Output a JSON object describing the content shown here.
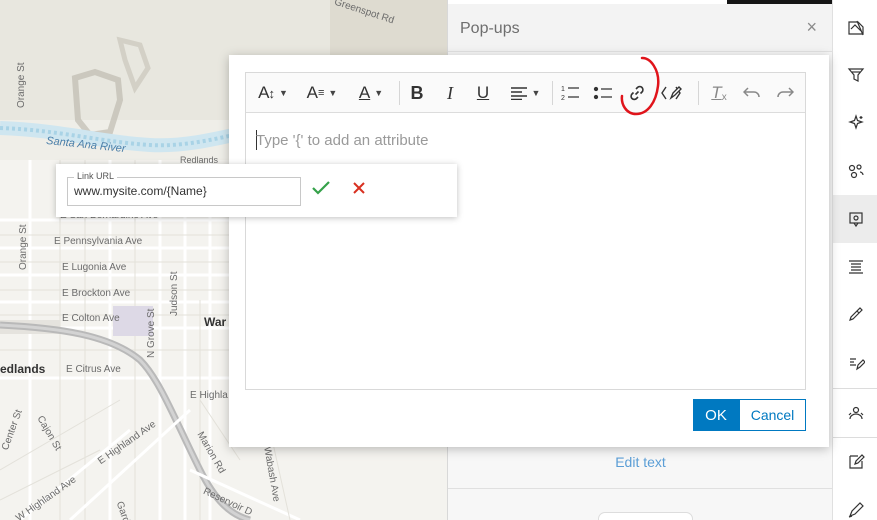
{
  "map": {
    "labels": {
      "greenspot": "Greenspot Rd",
      "orange_st_1": "Orange St",
      "santa_ana": "Santa Ana River",
      "redlands_small": "Redlands",
      "e_san_bernardino": "E San Bernardino Ave",
      "orange_st_2": "Orange St",
      "e_pennsylvania": "E Pennsylvania Ave",
      "e_lugonia": "E Lugonia Ave",
      "judson": "Judson St",
      "e_brockton": "E Brockton Ave",
      "e_colton": "E Colton Ave",
      "n_grove": "N Grove St",
      "war": "War",
      "redlands_city": "edlands",
      "e_citrus": "E Citrus Ave",
      "e_highla": "E Highla",
      "center_st": "Center St",
      "cajon": "Cajon St",
      "e_highland": "E Highland Ave",
      "marion": "Marion Rd",
      "wabash": "Wabash Ave",
      "w_highland": "W Highland Ave",
      "reservoir": "Reservoir D",
      "garden": "Gard"
    }
  },
  "panel": {
    "title": "Pop-ups",
    "close_icon": "×",
    "edit_text": "Edit text"
  },
  "dialog": {
    "placeholder": "Type '{' to add an attribute",
    "ok_label": "OK",
    "cancel_label": "Cancel"
  },
  "link_popover": {
    "legend": "Link URL",
    "value": "www.mysite.com/{Name}"
  },
  "colors": {
    "accent": "#0079c1",
    "check": "#35a14a",
    "cancel_x": "#d83020",
    "annotation": "#e0141b",
    "edit_text": "#5b9ed6"
  },
  "icons": {
    "toolbar": [
      "font-size-icon",
      "font-family-icon",
      "font-color-icon",
      "bold-icon",
      "italic-icon",
      "underline-icon",
      "align-icon",
      "ordered-list-icon",
      "bulleted-list-icon",
      "link-icon",
      "insert-expression-icon",
      "clear-format-icon",
      "undo-icon",
      "redo-icon"
    ],
    "actionbar": [
      "map-layers-icon",
      "filter-icon",
      "effects-icon",
      "clustering-icon",
      "popups-icon",
      "fields-icon",
      "styles-icon",
      "labels-icon",
      "forms-icon",
      "edit-icon",
      "sketch-icon"
    ]
  }
}
